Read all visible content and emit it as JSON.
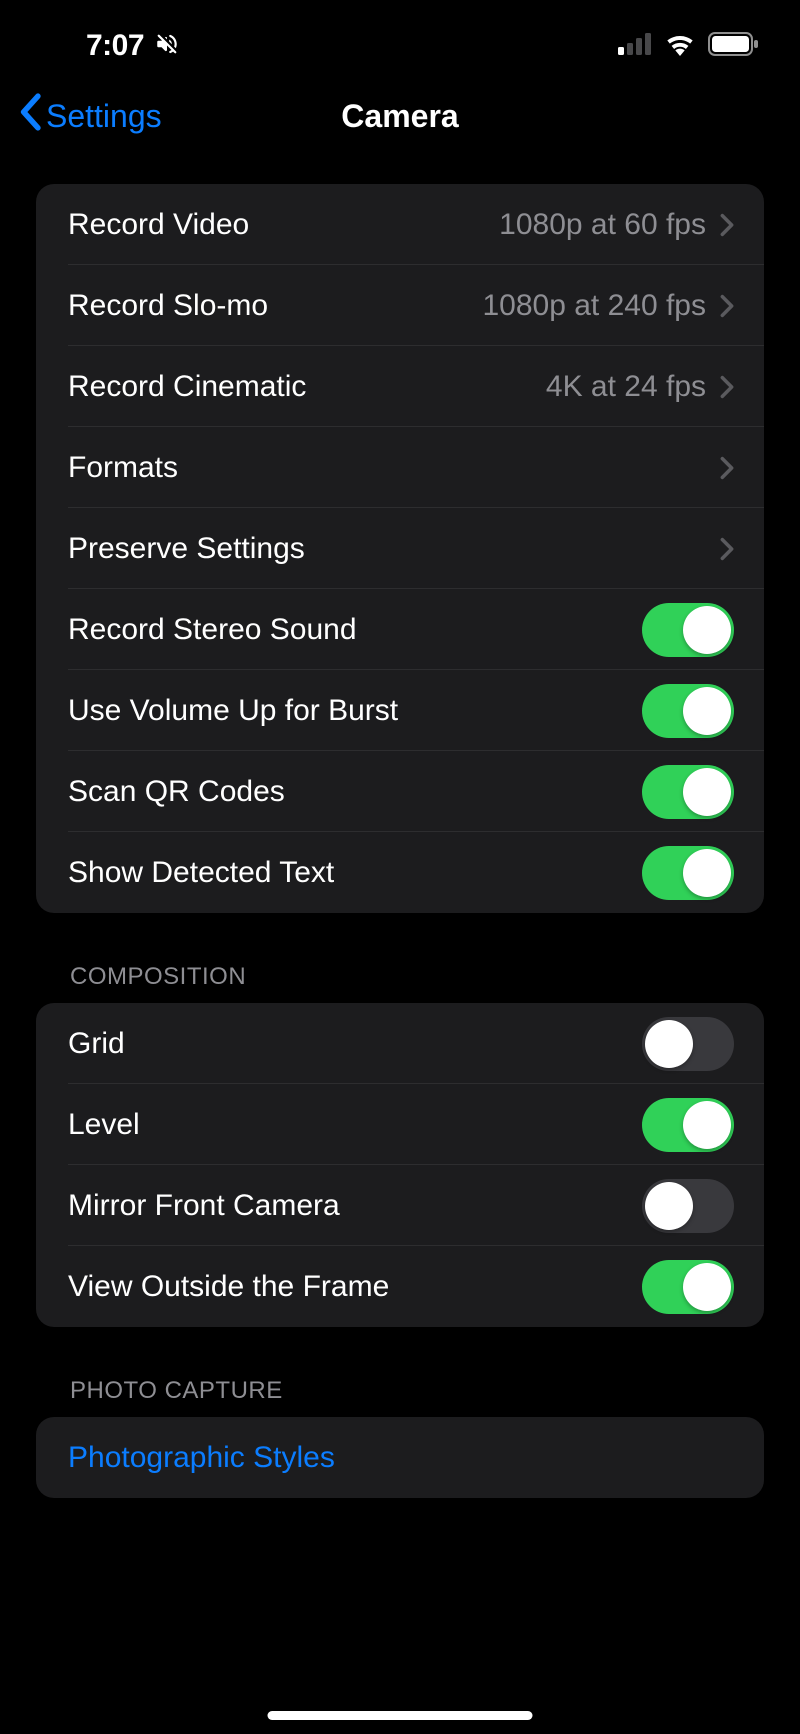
{
  "status": {
    "time": "7:07"
  },
  "nav": {
    "back": "Settings",
    "title": "Camera"
  },
  "sections": {
    "main": {
      "items": [
        {
          "label": "Record Video",
          "detail": "1080p at 60 fps"
        },
        {
          "label": "Record Slo-mo",
          "detail": "1080p at 240 fps"
        },
        {
          "label": "Record Cinematic",
          "detail": "4K at 24 fps"
        },
        {
          "label": "Formats"
        },
        {
          "label": "Preserve Settings"
        },
        {
          "label": "Record Stereo Sound",
          "toggle": true
        },
        {
          "label": "Use Volume Up for Burst",
          "toggle": true
        },
        {
          "label": "Scan QR Codes",
          "toggle": true
        },
        {
          "label": "Show Detected Text",
          "toggle": true
        }
      ]
    },
    "composition": {
      "header": "COMPOSITION",
      "items": [
        {
          "label": "Grid",
          "toggle": false
        },
        {
          "label": "Level",
          "toggle": true
        },
        {
          "label": "Mirror Front Camera",
          "toggle": false
        },
        {
          "label": "View Outside the Frame",
          "toggle": true
        }
      ]
    },
    "photo_capture": {
      "header": "PHOTO CAPTURE",
      "items": [
        {
          "label": "Photographic Styles"
        }
      ]
    }
  }
}
